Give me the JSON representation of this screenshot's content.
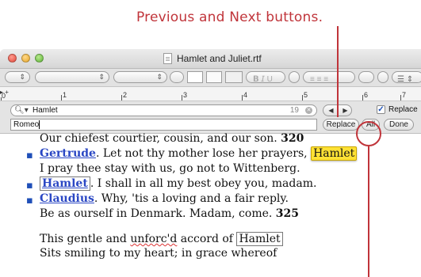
{
  "annotation": {
    "caption": "Previous and Next buttons."
  },
  "window": {
    "title": "Hamlet and Juliet.rtf"
  },
  "ruler": {
    "numbers": [
      "0",
      "1",
      "2",
      "3",
      "4",
      "5",
      "6",
      "7"
    ]
  },
  "find": {
    "search_value": "Hamlet",
    "match_count": "19",
    "prev_glyph": "◀",
    "next_glyph": "▶",
    "replace_checkbox_label": "Replace",
    "replace_value": "Romeo",
    "replace_button": "Replace",
    "all_button": "All",
    "done_button": "Done"
  },
  "document": {
    "lines": {
      "l1_text": "Our chiefest courtier, cousin, and our son. ",
      "l1_num": "320",
      "l2_speaker": "Gertrude",
      "l2_text": ". Let not thy mother lose her prayers, ",
      "l2_match": "Hamlet",
      "l3_text": "I pray thee stay with us, go not to Wittenberg.",
      "l4_speaker": "Hamlet",
      "l4_text": ". I shall in all my best obey you, madam.",
      "l5_speaker": "Claudius",
      "l5_text": ". Why, 'tis a loving and a fair reply.",
      "l6_text": "Be as ourself in Denmark. Madam, come. ",
      "l6_num": "325",
      "l7_text_a": "This gentle and ",
      "l7_misspelled": "unforc'd",
      "l7_text_b": " accord of ",
      "l7_match": "Hamlet",
      "l8_text": "Sits smiling to my heart; in grace whereof"
    }
  },
  "colors": {
    "annotation_red": "#c0343a",
    "speaker_blue": "#2a47c4",
    "highlight_yellow": "#ffe135"
  }
}
